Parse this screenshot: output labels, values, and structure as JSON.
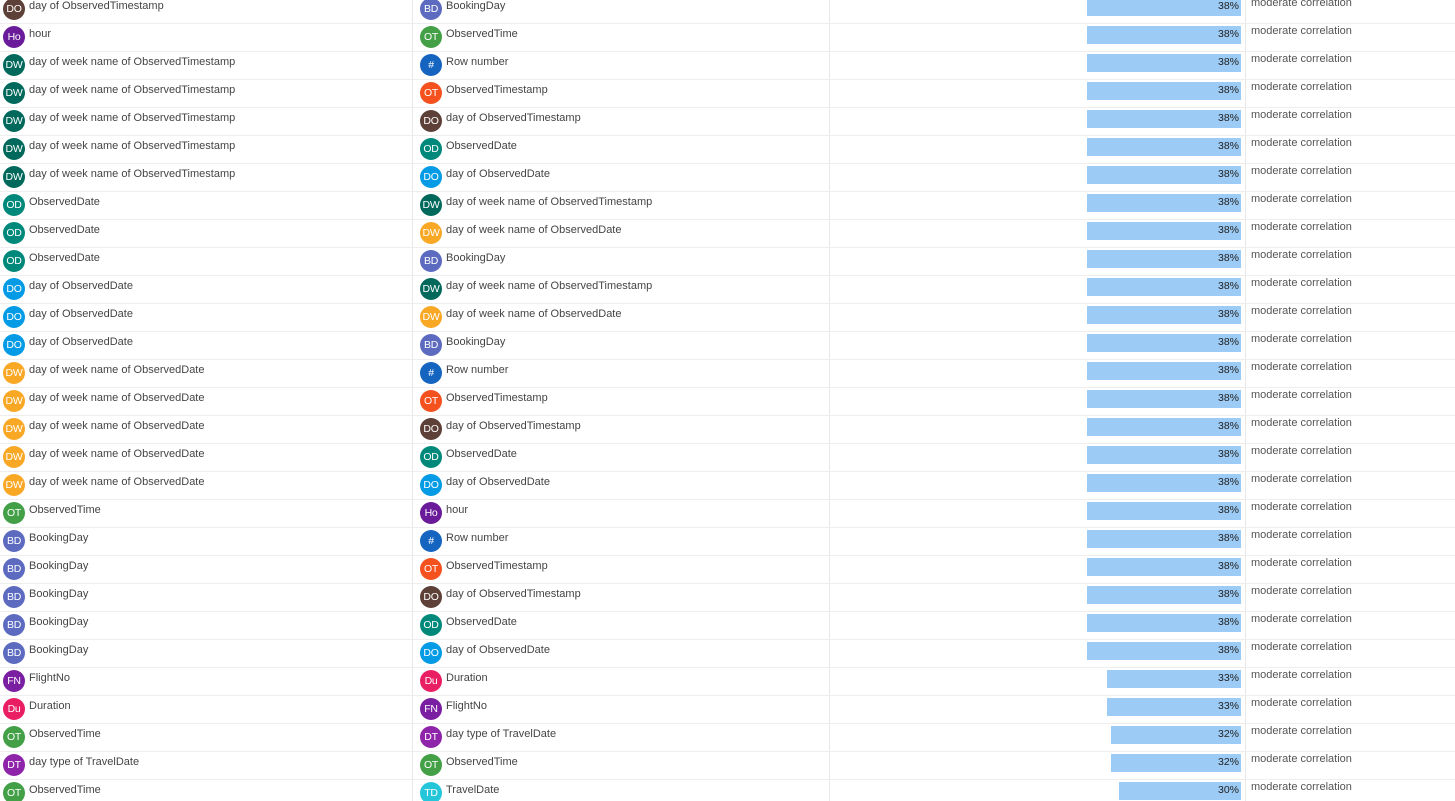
{
  "fields": {
    "DOts": {
      "label": "day of ObservedTimestamp",
      "abbr": "DO",
      "color": "#5d4037"
    },
    "Ho": {
      "label": "hour",
      "abbr": "Ho",
      "color": "#6a1b9a"
    },
    "DWts": {
      "label": "day of week name of ObservedTimestamp",
      "abbr": "DW",
      "color": "#00695c"
    },
    "OD": {
      "label": "ObservedDate",
      "abbr": "OD",
      "color": "#00897b"
    },
    "DOd": {
      "label": "day of ObservedDate",
      "abbr": "DO",
      "color": "#039be5"
    },
    "DWd": {
      "label": "day of week name of ObservedDate",
      "abbr": "DW",
      "color": "#f9a825"
    },
    "OT": {
      "label": "ObservedTime",
      "abbr": "OT",
      "color": "#43a047"
    },
    "BD": {
      "label": "BookingDay",
      "abbr": "BD",
      "color": "#5c6bc0"
    },
    "RN": {
      "label": "Row number",
      "abbr": "#",
      "color": "#1565c0"
    },
    "OTs": {
      "label": "ObservedTimestamp",
      "abbr": "OT",
      "color": "#f4511e"
    },
    "FN": {
      "label": "FlightNo",
      "abbr": "FN",
      "color": "#7b1fa2"
    },
    "Du": {
      "label": "Duration",
      "abbr": "Du",
      "color": "#e91e63"
    },
    "DT": {
      "label": "day type of TravelDate",
      "abbr": "DT",
      "color": "#8e24aa"
    },
    "TD": {
      "label": "TravelDate",
      "abbr": "TD",
      "color": "#26c6da"
    }
  },
  "rows": [
    {
      "a": "DOts",
      "b": "BD",
      "value": 38,
      "display": "38%",
      "description": "moderate correlation"
    },
    {
      "a": "Ho",
      "b": "OT",
      "value": 38,
      "display": "38%",
      "description": "moderate correlation"
    },
    {
      "a": "DWts",
      "b": "RN",
      "value": 38,
      "display": "38%",
      "description": "moderate correlation"
    },
    {
      "a": "DWts",
      "b": "OTs",
      "value": 38,
      "display": "38%",
      "description": "moderate correlation"
    },
    {
      "a": "DWts",
      "b": "DOts",
      "value": 38,
      "display": "38%",
      "description": "moderate correlation"
    },
    {
      "a": "DWts",
      "b": "OD",
      "value": 38,
      "display": "38%",
      "description": "moderate correlation"
    },
    {
      "a": "DWts",
      "b": "DOd",
      "value": 38,
      "display": "38%",
      "description": "moderate correlation"
    },
    {
      "a": "OD",
      "b": "DWts",
      "value": 38,
      "display": "38%",
      "description": "moderate correlation"
    },
    {
      "a": "OD",
      "b": "DWd",
      "value": 38,
      "display": "38%",
      "description": "moderate correlation"
    },
    {
      "a": "OD",
      "b": "BD",
      "value": 38,
      "display": "38%",
      "description": "moderate correlation"
    },
    {
      "a": "DOd",
      "b": "DWts",
      "value": 38,
      "display": "38%",
      "description": "moderate correlation"
    },
    {
      "a": "DOd",
      "b": "DWd",
      "value": 38,
      "display": "38%",
      "description": "moderate correlation"
    },
    {
      "a": "DOd",
      "b": "BD",
      "value": 38,
      "display": "38%",
      "description": "moderate correlation"
    },
    {
      "a": "DWd",
      "b": "RN",
      "value": 38,
      "display": "38%",
      "description": "moderate correlation"
    },
    {
      "a": "DWd",
      "b": "OTs",
      "value": 38,
      "display": "38%",
      "description": "moderate correlation"
    },
    {
      "a": "DWd",
      "b": "DOts",
      "value": 38,
      "display": "38%",
      "description": "moderate correlation"
    },
    {
      "a": "DWd",
      "b": "OD",
      "value": 38,
      "display": "38%",
      "description": "moderate correlation"
    },
    {
      "a": "DWd",
      "b": "DOd",
      "value": 38,
      "display": "38%",
      "description": "moderate correlation"
    },
    {
      "a": "OT",
      "b": "Ho",
      "value": 38,
      "display": "38%",
      "description": "moderate correlation"
    },
    {
      "a": "BD",
      "b": "RN",
      "value": 38,
      "display": "38%",
      "description": "moderate correlation"
    },
    {
      "a": "BD",
      "b": "OTs",
      "value": 38,
      "display": "38%",
      "description": "moderate correlation"
    },
    {
      "a": "BD",
      "b": "DOts",
      "value": 38,
      "display": "38%",
      "description": "moderate correlation"
    },
    {
      "a": "BD",
      "b": "OD",
      "value": 38,
      "display": "38%",
      "description": "moderate correlation"
    },
    {
      "a": "BD",
      "b": "DOd",
      "value": 38,
      "display": "38%",
      "description": "moderate correlation"
    },
    {
      "a": "FN",
      "b": "Du",
      "value": 33,
      "display": "33%",
      "description": "moderate correlation"
    },
    {
      "a": "Du",
      "b": "FN",
      "value": 33,
      "display": "33%",
      "description": "moderate correlation"
    },
    {
      "a": "OT",
      "b": "DT",
      "value": 32,
      "display": "32%",
      "description": "moderate correlation"
    },
    {
      "a": "DT",
      "b": "OT",
      "value": 32,
      "display": "32%",
      "description": "moderate correlation"
    },
    {
      "a": "OT",
      "b": "TD",
      "value": 30,
      "display": "30%",
      "description": "moderate correlation"
    }
  ]
}
